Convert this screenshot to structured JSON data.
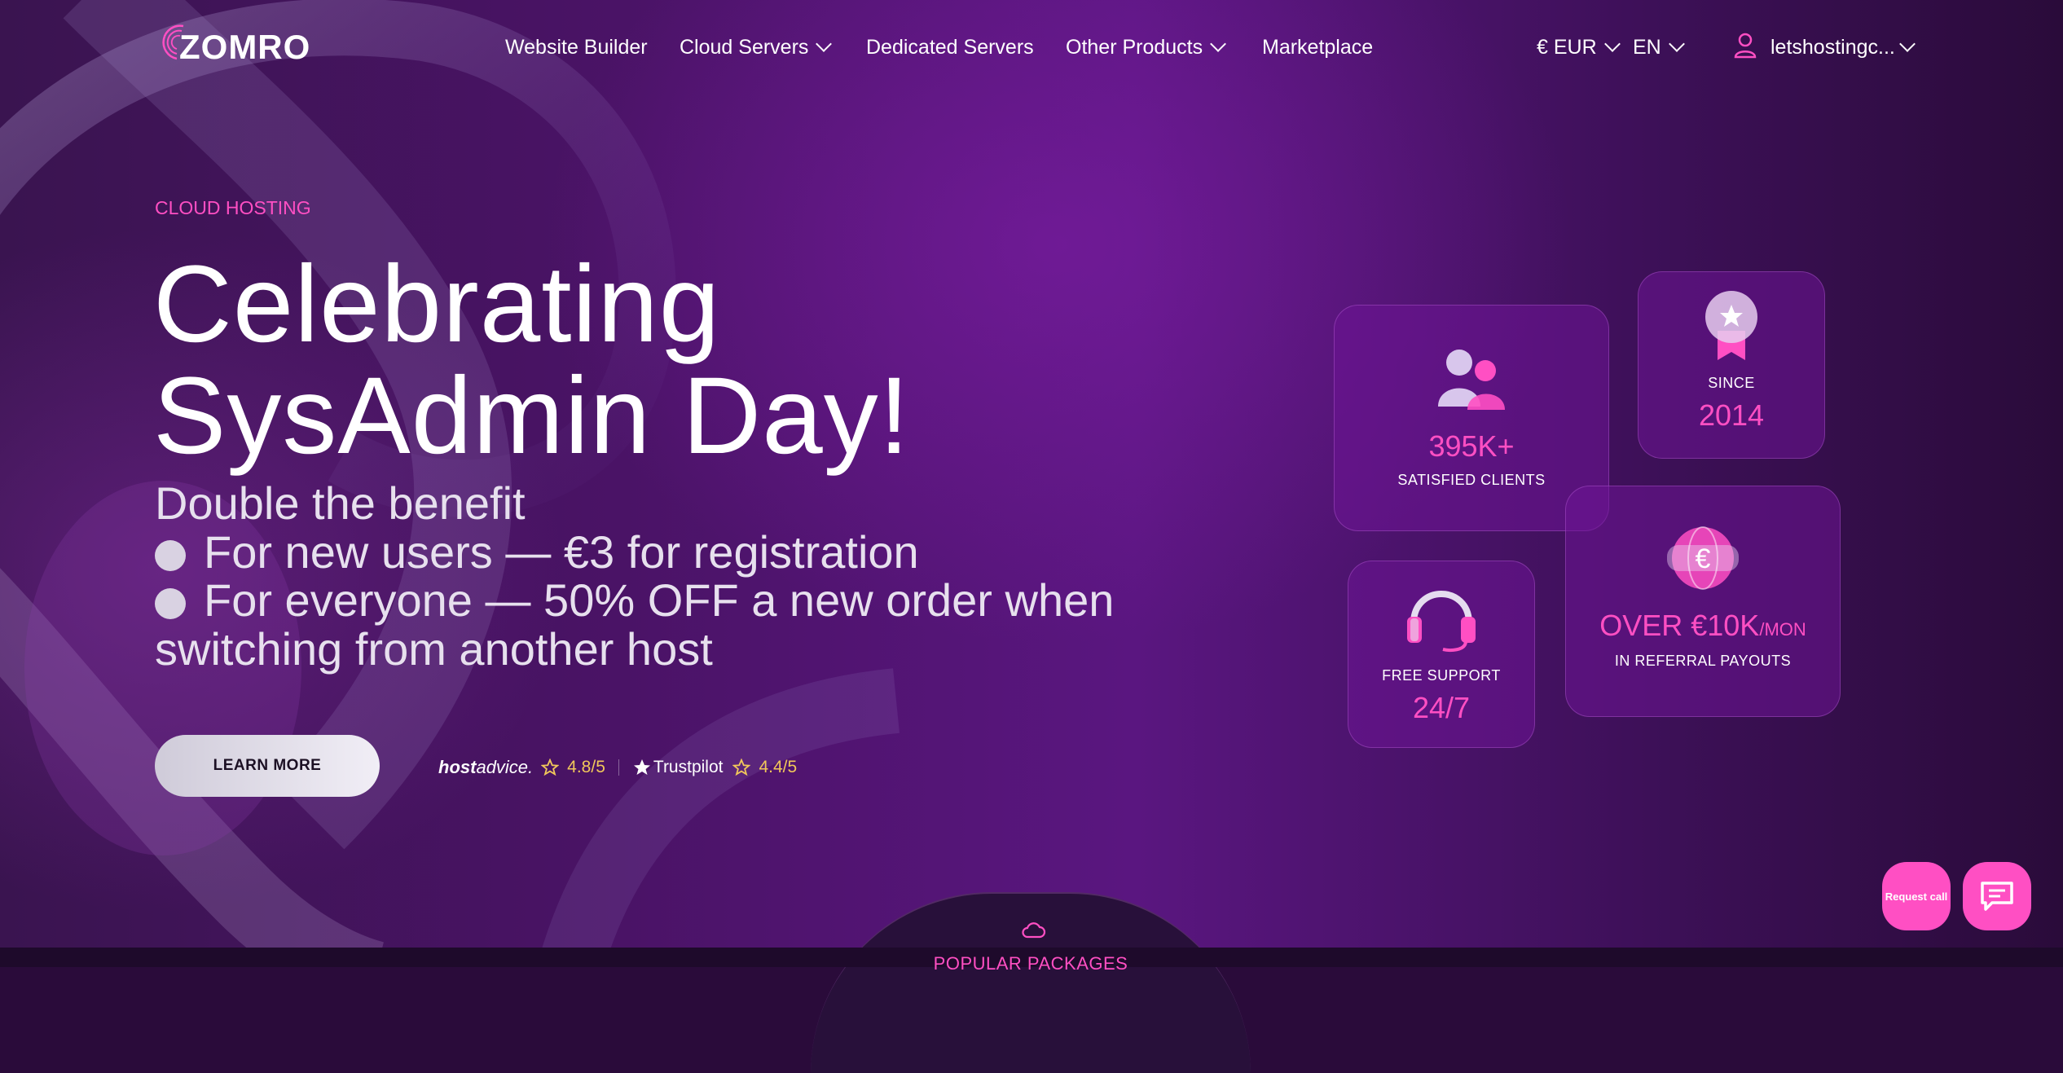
{
  "brand": {
    "logo_text": "ZOMRO"
  },
  "nav": {
    "items": [
      {
        "label": "Website Builder"
      },
      {
        "label": "Cloud Servers"
      },
      {
        "label": "Dedicated Servers"
      },
      {
        "label": "Other Products"
      },
      {
        "label": "Marketplace"
      }
    ],
    "currency": "€ EUR",
    "language": "EN",
    "account": "letshostingc..."
  },
  "hero": {
    "eyebrow": "CLOUD HOSTING",
    "title_line1": "Celebrating",
    "title_line2": "SysAdmin Day!",
    "subtitle": "Double the benefit",
    "bullet1": "For new users — €3 for registration",
    "bullet2_line1": "For everyone — 50% OFF a new order when",
    "bullet2_line2": "switching from another host",
    "cta": "LEARN MORE"
  },
  "ratings": {
    "hostadvice_brand_bold": "host",
    "hostadvice_brand_rest": "advice.",
    "hostadvice_score": "4.8/5",
    "trustpilot_brand": "Trustpilot",
    "trustpilot_score": "4.4/5"
  },
  "stats": {
    "clients_value": "395K+",
    "clients_label": "SATISFIED CLIENTS",
    "since_label": "SINCE",
    "since_value": "2014",
    "support_label": "FREE SUPPORT",
    "support_value": "24/7",
    "referral_value": "OVER €10K",
    "referral_unit": "/MON",
    "referral_label": "IN REFERRAL PAYOUTS"
  },
  "bottom": {
    "section_label": "POPULAR PACKAGES"
  },
  "floating": {
    "request_call": "Request call"
  },
  "colors": {
    "accent": "#ff4fc3",
    "rating": "#f1c75a",
    "background": "#4a1366"
  },
  "icons": [
    "user-icon",
    "chevron-down-icon",
    "people-icon",
    "medal-icon",
    "headset-icon",
    "euro-globe-icon",
    "cloud-icon",
    "chat-icon",
    "star-icon"
  ]
}
